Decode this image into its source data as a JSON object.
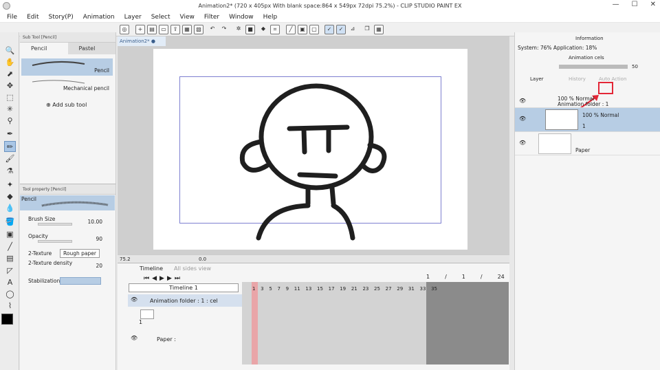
{
  "title": "Animation2* (720 x 405px With blank space:864 x 549px 72dpi 75.2%) - CLIP STUDIO PAINT EX",
  "window_buttons": [
    "—",
    "☐",
    "✕"
  ],
  "menu": [
    "File",
    "Edit",
    "Story(P)",
    "Animation",
    "Layer",
    "Select",
    "View",
    "Filter",
    "Window",
    "Help"
  ],
  "doc_tab": "Animation2*",
  "subtool": {
    "header": "Sub Tool [Pencil]",
    "tabs": [
      "Pencil",
      "Pastel"
    ],
    "items": [
      "Pencil",
      "Mechanical pencil"
    ],
    "add": "Add sub tool"
  },
  "toolprop": {
    "header": "Tool property [Pencil]",
    "name": "Pencil",
    "brush_size_label": "Brush Size",
    "brush_size": "10.00",
    "opacity_label": "Opacity",
    "opacity": "90",
    "texture_label": "2-Texture",
    "texture_value": "Rough paper",
    "texture_density_label": "2-Texture density",
    "texture_density": "20",
    "stabilization_label": "Stabilization"
  },
  "status": {
    "zoom": "75.2",
    "angle": "0.0"
  },
  "timeline": {
    "tabs": [
      "Timeline",
      "All sides view"
    ],
    "name": "Timeline 1",
    "folder_label": "Animation folder : 1 : cel",
    "paper_label": "Paper :",
    "frames": [
      "1",
      "3",
      "5",
      "7",
      "9",
      "11",
      "13",
      "15",
      "17",
      "19",
      "21",
      "23",
      "25",
      "27",
      "29",
      "31",
      "33",
      "35"
    ],
    "right_counter": [
      "1",
      "/",
      "1",
      "/",
      "24"
    ],
    "cel_num": "1"
  },
  "right": {
    "info_tabs": [
      "Information"
    ],
    "system": "System: 76%  Application: 18%",
    "anim_cels": "Animation cels",
    "opacity": "50",
    "layer_tabs": [
      "Layer",
      "History",
      "Auto Action"
    ],
    "folder": {
      "mode": "100 % Normal",
      "name": "Animation folder : 1"
    },
    "cel": {
      "mode": "100 % Normal",
      "name": "1"
    },
    "paper": "Paper"
  },
  "colors": {
    "accent": "#b7cde4",
    "highlight": "#e32636",
    "frame": "#7d7fd0"
  }
}
